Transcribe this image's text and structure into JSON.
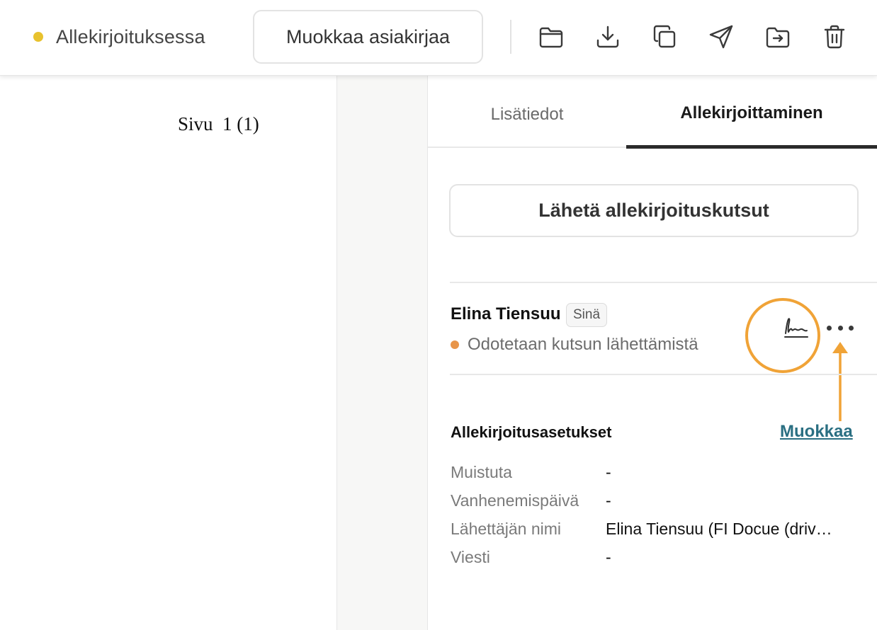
{
  "toolbar": {
    "status_label": "Allekirjoituksessa",
    "status_color": "#e8c22e",
    "edit_document_label": "Muokkaa asiakirjaa",
    "icons": [
      "folder-icon",
      "download-icon",
      "copy-icon",
      "send-icon",
      "move-icon",
      "trash-icon"
    ]
  },
  "document": {
    "page_label": "Sivu  1 (1)"
  },
  "panel": {
    "tabs": [
      {
        "label": "Lisätiedot",
        "active": false
      },
      {
        "label": "Allekirjoittaminen",
        "active": true
      }
    ],
    "send_invites_label": "Lähetä allekirjoituskutsut",
    "signer": {
      "name": "Elina Tiensuu",
      "badge": "Sinä",
      "status": "Odotetaan kutsun lähettämistä",
      "status_color": "#e8954a"
    },
    "settings": {
      "title": "Allekirjoitusasetukset",
      "edit_label": "Muokkaa",
      "rows": [
        {
          "label": "Muistuta",
          "value": "-"
        },
        {
          "label": "Vanhenemispäivä",
          "value": "-"
        },
        {
          "label": "Lähettäjän nimi",
          "value": "Elina Tiensuu (FI Docue (driv…"
        },
        {
          "label": "Viesti",
          "value": "-"
        }
      ]
    },
    "highlight_color": "#f0a337",
    "accent_link_color": "#2a6f82"
  }
}
